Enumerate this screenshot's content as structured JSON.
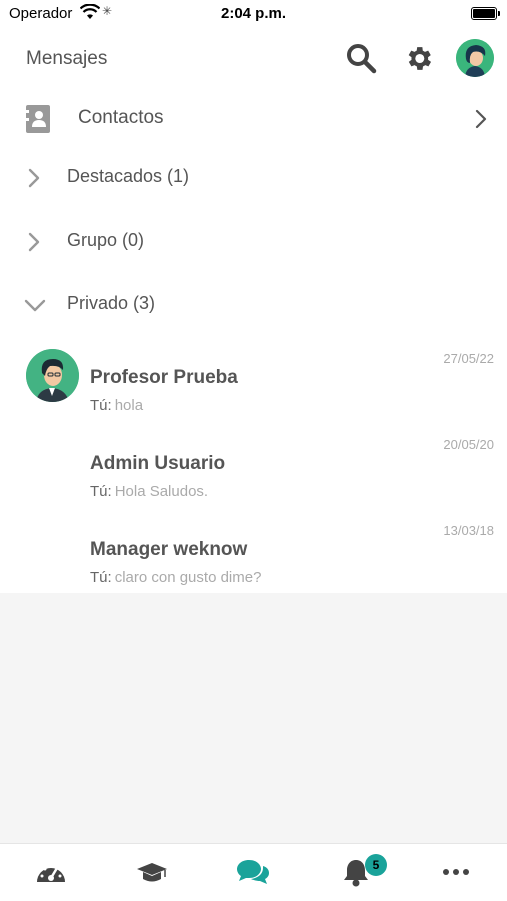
{
  "status_bar": {
    "carrier": "Operador",
    "time": "2:04 p.m."
  },
  "header": {
    "title": "Mensajes"
  },
  "contacts": {
    "label": "Contactos"
  },
  "sections": [
    {
      "label": "Destacados (1)",
      "expanded": false
    },
    {
      "label": "Grupo (0)",
      "expanded": false
    },
    {
      "label": "Privado (3)",
      "expanded": true
    }
  ],
  "conversations": [
    {
      "name": "Profesor Prueba",
      "prefix": "Tú:",
      "message": "hola",
      "date": "27/05/22"
    },
    {
      "name": "Admin Usuario",
      "prefix": "Tú:",
      "message": "Hola Saludos.",
      "date": "20/05/20"
    },
    {
      "name": "Manager weknow",
      "prefix": "Tú:",
      "message": "claro con gusto dime?",
      "date": "13/03/18"
    }
  ],
  "tab_bar": {
    "tabs": [
      {
        "icon": "dashboard-icon"
      },
      {
        "icon": "graduation-cap-icon"
      },
      {
        "icon": "chat-icon",
        "active": true
      },
      {
        "icon": "bell-icon"
      },
      {
        "icon": "more-icon"
      }
    ],
    "notification_count": "5"
  },
  "colors": {
    "accent": "#1aa39a",
    "text": "#555555",
    "muted": "#aaaaaa",
    "background": "#f5f5f5"
  }
}
